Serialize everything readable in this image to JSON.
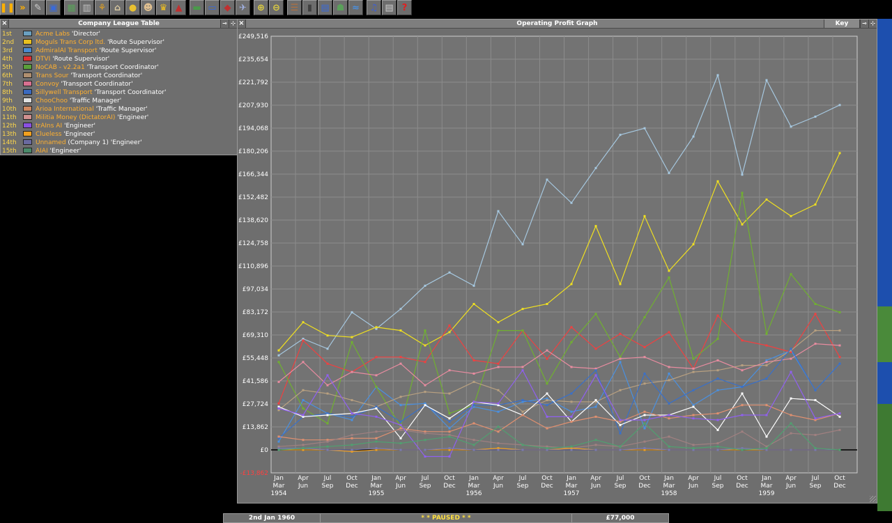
{
  "toolbar": {
    "buttons": [
      {
        "name": "pause-button",
        "icon": "pause-icon",
        "glyph": "❚❚",
        "color": "#ffb000",
        "active": true
      },
      {
        "name": "fast-forward-button",
        "icon": "fast-forward-icon",
        "glyph": "»",
        "color": "#ffb000"
      },
      {
        "name": "settings-button",
        "icon": "wrench-icon",
        "glyph": "✎",
        "color": "#cccccc"
      },
      {
        "name": "save-button",
        "icon": "floppy-disk-icon",
        "glyph": "▣",
        "color": "#3a6ad8"
      },
      {
        "name": "map-button",
        "icon": "map-icon",
        "glyph": "▦",
        "color": "#5aa05a"
      },
      {
        "name": "town-directory-button",
        "icon": "town-icon",
        "glyph": "▥",
        "color": "#c0c0c0"
      },
      {
        "name": "subsidies-button",
        "icon": "subsidies-icon",
        "glyph": "⚘",
        "color": "#e0a020"
      },
      {
        "name": "station-list-button",
        "icon": "station-icon",
        "glyph": "⌂",
        "color": "#d8c8a0"
      },
      {
        "name": "finances-button",
        "icon": "coins-icon",
        "glyph": "●",
        "color": "#e8c030"
      },
      {
        "name": "company-button",
        "icon": "company-manager-icon",
        "glyph": "☻",
        "color": "#e0c090"
      },
      {
        "name": "league-table-button",
        "icon": "trophy-icon",
        "glyph": "♛",
        "color": "#f0c020"
      },
      {
        "name": "graphs-button",
        "icon": "graph-icon",
        "glyph": "▲",
        "color": "#c03030"
      },
      {
        "name": "train-list-button",
        "icon": "train-icon",
        "glyph": "▬",
        "color": "#4a9a4a"
      },
      {
        "name": "road-vehicle-list-button",
        "icon": "bus-icon",
        "glyph": "▭",
        "color": "#3a6ad8"
      },
      {
        "name": "ship-list-button",
        "icon": "ship-icon",
        "glyph": "◆",
        "color": "#c03030"
      },
      {
        "name": "aircraft-list-button",
        "icon": "aircraft-icon",
        "glyph": "✈",
        "color": "#a0b0e0"
      },
      {
        "name": "zoom-in-button",
        "icon": "zoom-in-icon",
        "glyph": "⊕",
        "color": "#e0d040"
      },
      {
        "name": "zoom-out-button",
        "icon": "zoom-out-icon",
        "glyph": "⊖",
        "color": "#e0d040"
      },
      {
        "name": "build-railway-button",
        "icon": "railway-icon",
        "glyph": "☰",
        "color": "#b07040"
      },
      {
        "name": "build-road-button",
        "icon": "road-icon",
        "glyph": "▮",
        "color": "#404040"
      },
      {
        "name": "build-tram-button",
        "icon": "tram-icon",
        "glyph": "▤",
        "color": "#3a6ad8"
      },
      {
        "name": "landscaping-button",
        "icon": "landscaping-icon",
        "glyph": "☗",
        "color": "#5aa05a"
      },
      {
        "name": "build-waterways-button",
        "icon": "water-icon",
        "glyph": "≈",
        "color": "#4a90e0"
      },
      {
        "name": "music-button",
        "icon": "music-icon",
        "glyph": "♫",
        "color": "#4060d0"
      },
      {
        "name": "news-button",
        "icon": "newspaper-icon",
        "glyph": "▤",
        "color": "#d0d0d0"
      },
      {
        "name": "help-button",
        "icon": "question-mark-icon",
        "glyph": "?",
        "color": "#e02020"
      }
    ]
  },
  "league": {
    "title": "Company League Table",
    "rows": [
      {
        "rank": "1st",
        "name": "Acme Labs",
        "extra": "",
        "title": "'Director'",
        "color": "#6aa0c0"
      },
      {
        "rank": "2nd",
        "name": "Moguls Trans Corp ltd.",
        "extra": "",
        "title": "'Route Supervisor'",
        "color": "#e8c020"
      },
      {
        "rank": "3rd",
        "name": "AdmiralAI Transport",
        "extra": "",
        "title": "'Route Supervisor'",
        "color": "#4a8ad0"
      },
      {
        "rank": "4th",
        "name": "DTVI",
        "extra": "",
        "title": "'Route Supervisor'",
        "color": "#e03030"
      },
      {
        "rank": "5th",
        "name": "NoCAB - v2.2a1",
        "extra": "",
        "title": "'Transport Coordinator'",
        "color": "#5aa03a"
      },
      {
        "rank": "6th",
        "name": "Trans Sour",
        "extra": "",
        "title": "'Transport Coordinator'",
        "color": "#b09070"
      },
      {
        "rank": "7th",
        "name": "Convoy",
        "extra": "",
        "title": "'Transport Coordinator'",
        "color": "#d87090"
      },
      {
        "rank": "8th",
        "name": "Sillywell Transport",
        "extra": "",
        "title": "'Transport Coordinator'",
        "color": "#3a6ac0"
      },
      {
        "rank": "9th",
        "name": "ChooChoo",
        "extra": "",
        "title": "'Traffic Manager'",
        "color": "#e0e0e0"
      },
      {
        "rank": "10th",
        "name": "Arioa International",
        "extra": "",
        "title": "'Traffic Manager'",
        "color": "#d08860"
      },
      {
        "rank": "11th",
        "name": "Militia Money (DictatorAI)",
        "extra": "",
        "title": "'Engineer'",
        "color": "#d09090"
      },
      {
        "rank": "12th",
        "name": "trAIns AI",
        "extra": "",
        "title": "'Engineer'",
        "color": "#8a50e0"
      },
      {
        "rank": "13th",
        "name": "Clueless",
        "extra": "",
        "title": "'Engineer'",
        "color": "#f0a020"
      },
      {
        "rank": "14th",
        "name": "Unnamed",
        "extra": "(Company 1)",
        "title": "'Engineer'",
        "color": "#6a6aa0"
      },
      {
        "rank": "15th",
        "name": "AIAI",
        "extra": "",
        "title": "'Engineer'",
        "color": "#4a8a6a"
      }
    ]
  },
  "graph": {
    "title": "Operating Profit Graph",
    "key_label": "Key"
  },
  "chart_data": {
    "type": "line",
    "title": "Operating Profit Graph",
    "ylim": [
      -13862,
      249516
    ],
    "grid": true,
    "y_ticks": [
      "£249,516",
      "£235,654",
      "£221,792",
      "£207,930",
      "£194,068",
      "£180,206",
      "£166,344",
      "£152,482",
      "£138,620",
      "£124,758",
      "£110,896",
      "£97,034",
      "£83,172",
      "£69,310",
      "£55,448",
      "£41,586",
      "£27,724",
      "£13,862",
      "£0",
      "-£13,862"
    ],
    "x_labels": [
      [
        "Jan",
        "Mar",
        "1954"
      ],
      [
        "Apr",
        "Jun",
        ""
      ],
      [
        "Jul",
        "Sep",
        ""
      ],
      [
        "Oct",
        "Dec",
        ""
      ],
      [
        "Jan",
        "Mar",
        "1955"
      ],
      [
        "Apr",
        "Jun",
        ""
      ],
      [
        "Jul",
        "Sep",
        ""
      ],
      [
        "Oct",
        "Dec",
        ""
      ],
      [
        "Jan",
        "Mar",
        "1956"
      ],
      [
        "Apr",
        "Jun",
        ""
      ],
      [
        "Jul",
        "Sep",
        ""
      ],
      [
        "Oct",
        "Dec",
        ""
      ],
      [
        "Jan",
        "Mar",
        "1957"
      ],
      [
        "Apr",
        "Jun",
        ""
      ],
      [
        "Jul",
        "Sep",
        ""
      ],
      [
        "Oct",
        "Dec",
        ""
      ],
      [
        "Jan",
        "Mar",
        "1958"
      ],
      [
        "Apr",
        "Jun",
        ""
      ],
      [
        "Jul",
        "Sep",
        ""
      ],
      [
        "Oct",
        "Dec",
        ""
      ],
      [
        "Jan",
        "Mar",
        "1959"
      ],
      [
        "Apr",
        "Jun",
        ""
      ],
      [
        "Jul",
        "Sep",
        ""
      ],
      [
        "Oct",
        "Dec",
        ""
      ]
    ],
    "series": [
      {
        "color": "#a6c8e0",
        "values": [
          57000,
          67000,
          61000,
          83000,
          73000,
          85000,
          99000,
          107000,
          99000,
          144000,
          124000,
          163000,
          149000,
          170000,
          190000,
          194000,
          167000,
          189000,
          226000,
          166000,
          223000,
          195000,
          201000,
          208000
        ]
      },
      {
        "color": "#f0e020",
        "values": [
          60000,
          77000,
          69000,
          68000,
          74000,
          72000,
          63000,
          71000,
          88000,
          77000,
          85000,
          88000,
          100000,
          135000,
          100000,
          141000,
          108000,
          124000,
          162000,
          136000,
          151000,
          141000,
          148000,
          179000
        ]
      },
      {
        "color": "#4a90e0",
        "values": [
          5000,
          30000,
          22000,
          18000,
          38000,
          27000,
          28000,
          13000,
          26000,
          23000,
          29000,
          31000,
          23000,
          26000,
          53000,
          13000,
          46000,
          27000,
          36000,
          38000,
          54000,
          60000,
          36000,
          52000
        ]
      },
      {
        "color": "#f04040",
        "values": [
          28000,
          66000,
          52000,
          47000,
          56000,
          56000,
          53000,
          75000,
          54000,
          52000,
          72000,
          55000,
          74000,
          61000,
          70000,
          62000,
          71000,
          49000,
          81000,
          66000,
          63000,
          59000,
          82000,
          56000
        ]
      },
      {
        "color": "#70b030",
        "values": [
          53000,
          25000,
          16000,
          65000,
          38000,
          14000,
          72000,
          22000,
          27000,
          72000,
          72000,
          40000,
          65000,
          82000,
          56000,
          80000,
          104000,
          55000,
          67000,
          155000,
          70000,
          106000,
          88000,
          83000
        ]
      },
      {
        "color": "#b8a080",
        "values": [
          24000,
          36000,
          34000,
          30000,
          26000,
          32000,
          35000,
          34000,
          41000,
          36000,
          23000,
          30000,
          29000,
          29000,
          36000,
          40000,
          42000,
          47000,
          48000,
          51000,
          51000,
          60000,
          72000,
          72000
        ]
      },
      {
        "color": "#e88ca0",
        "values": [
          41000,
          53000,
          39000,
          47000,
          45000,
          52000,
          39000,
          48000,
          46000,
          50000,
          50000,
          60000,
          50000,
          49000,
          55000,
          56000,
          50000,
          49000,
          54000,
          48000,
          53000,
          55000,
          64000,
          63000
        ]
      },
      {
        "color": "#3a70c8",
        "values": [
          7000,
          20000,
          22000,
          20000,
          26000,
          17000,
          27000,
          17000,
          27000,
          27000,
          30000,
          27000,
          34000,
          48000,
          10000,
          46000,
          28000,
          36000,
          43000,
          38000,
          43000,
          61000,
          36000,
          52000
        ]
      },
      {
        "color": "#ffffff",
        "values": [
          26000,
          20000,
          21000,
          22000,
          25000,
          7000,
          27000,
          19000,
          29000,
          27000,
          21000,
          34000,
          17000,
          30000,
          15000,
          21000,
          21000,
          26000,
          12000,
          34000,
          8000,
          31000,
          30000,
          20000
        ]
      },
      {
        "color": "#e09070",
        "values": [
          8000,
          6000,
          6000,
          7000,
          7000,
          13000,
          11000,
          11000,
          16000,
          11000,
          21000,
          13000,
          17000,
          20000,
          17000,
          23000,
          19000,
          21000,
          22000,
          27000,
          27000,
          21000,
          18000,
          22000
        ]
      },
      {
        "color": "#a08080",
        "values": [
          2000,
          3000,
          5000,
          9000,
          11000,
          12000,
          10000,
          9000,
          6000,
          4000,
          3000,
          2000,
          1000,
          3000,
          2000,
          5000,
          8000,
          3000,
          4000,
          11000,
          2000,
          10000,
          9000,
          12000
        ]
      },
      {
        "color": "#9060f0",
        "values": [
          25000,
          21000,
          45000,
          22000,
          20000,
          15000,
          -4000,
          -4000,
          29000,
          28000,
          48000,
          20000,
          20000,
          45000,
          18000,
          18000,
          21000,
          19000,
          18000,
          21000,
          21000,
          47000,
          19000,
          22000
        ]
      },
      {
        "color": "#f0a020",
        "values": [
          0,
          0,
          0,
          -1000,
          0,
          0,
          0,
          0,
          0,
          1000,
          0,
          0,
          1000,
          0,
          0,
          0,
          0,
          0,
          0,
          0,
          0,
          0,
          0,
          0
        ]
      },
      {
        "color": "#7a7ab0",
        "values": [
          1000,
          1000,
          0,
          0,
          1000,
          0,
          0,
          1000,
          0,
          0,
          0,
          0,
          0,
          0,
          0,
          1000,
          0,
          0,
          0,
          1000,
          0,
          0,
          0,
          0
        ]
      },
      {
        "color": "#50a070",
        "values": [
          0,
          1000,
          2000,
          3000,
          5000,
          4000,
          6000,
          8000,
          3000,
          14000,
          3000,
          1000,
          2000,
          6000,
          2000,
          16000,
          2000,
          1000,
          2000,
          0,
          1000,
          16000,
          1000,
          0
        ]
      }
    ]
  },
  "status": {
    "date": "2nd Jan 1960",
    "paused": "*  *  PAUSED  *  *",
    "money": "£77,000"
  }
}
